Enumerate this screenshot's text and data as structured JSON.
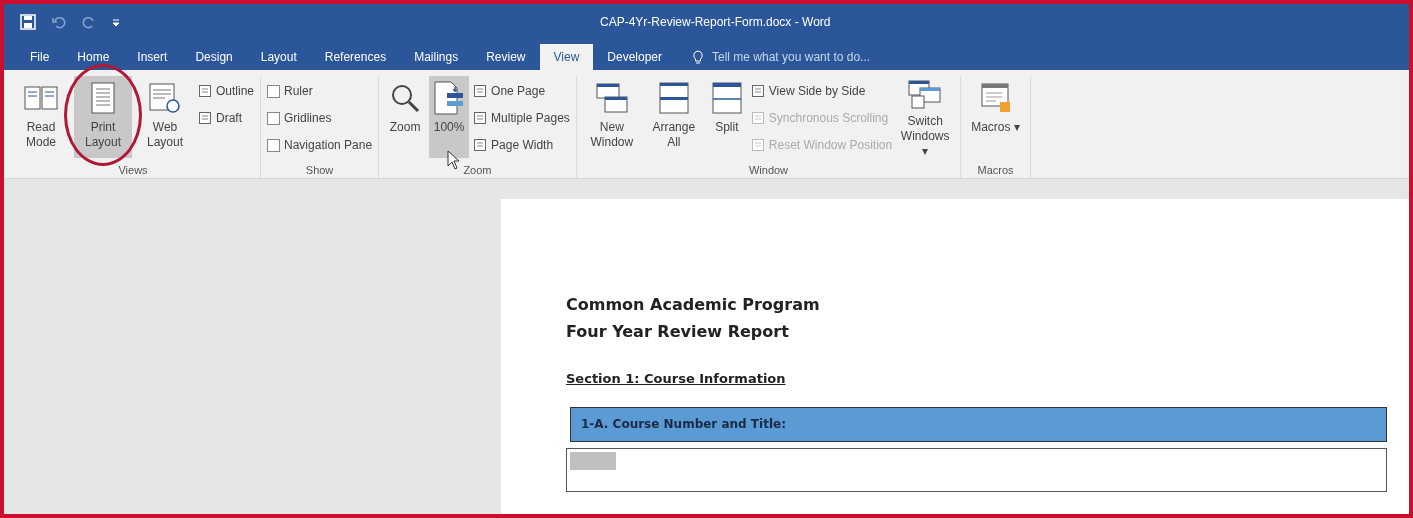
{
  "title_bar": {
    "title": "CAP-4Yr-Review-Report-Form.docx - Word"
  },
  "tabs": [
    {
      "label": "File",
      "selected": false
    },
    {
      "label": "Home",
      "selected": false
    },
    {
      "label": "Insert",
      "selected": false
    },
    {
      "label": "Design",
      "selected": false
    },
    {
      "label": "Layout",
      "selected": false
    },
    {
      "label": "References",
      "selected": false
    },
    {
      "label": "Mailings",
      "selected": false
    },
    {
      "label": "Review",
      "selected": false
    },
    {
      "label": "View",
      "selected": true
    },
    {
      "label": "Developer",
      "selected": false
    }
  ],
  "tell_me": {
    "placeholder": "Tell me what you want to do..."
  },
  "ribbon": {
    "groups": [
      {
        "label": "Views",
        "items": [
          {
            "kind": "large",
            "label": "Read Mode",
            "selected": false,
            "circled": false
          },
          {
            "kind": "large",
            "label": "Print Layout",
            "selected": true,
            "circled": true
          },
          {
            "kind": "large",
            "label": "Web Layout",
            "selected": false,
            "circled": false
          },
          {
            "kind": "column",
            "rows": [
              {
                "kind": "button",
                "label": "Outline",
                "disabled": false
              },
              {
                "kind": "button",
                "label": "Draft",
                "disabled": false
              }
            ]
          }
        ]
      },
      {
        "label": "Show",
        "items": [
          {
            "kind": "column",
            "rows": [
              {
                "kind": "checkbox",
                "label": "Ruler",
                "checked": false
              },
              {
                "kind": "checkbox",
                "label": "Gridlines",
                "checked": false
              },
              {
                "kind": "checkbox",
                "label": "Navigation Pane",
                "checked": false
              }
            ]
          }
        ]
      },
      {
        "label": "Zoom",
        "items": [
          {
            "kind": "large",
            "label": "Zoom",
            "selected": false,
            "circled": false
          },
          {
            "kind": "large",
            "label": "100%",
            "selected": true,
            "circled": false
          },
          {
            "kind": "column",
            "rows": [
              {
                "kind": "button",
                "label": "One Page",
                "disabled": false
              },
              {
                "kind": "button",
                "label": "Multiple Pages",
                "disabled": false
              },
              {
                "kind": "button",
                "label": "Page Width",
                "disabled": false
              }
            ]
          }
        ]
      },
      {
        "label": "Window",
        "items": [
          {
            "kind": "large",
            "label": "New Window",
            "selected": false,
            "circled": false
          },
          {
            "kind": "large",
            "label": "Arrange All",
            "selected": false,
            "circled": false
          },
          {
            "kind": "large",
            "label": "Split",
            "selected": false,
            "circled": false
          },
          {
            "kind": "column",
            "rows": [
              {
                "kind": "button",
                "label": "View Side by Side",
                "disabled": false
              },
              {
                "kind": "button",
                "label": "Synchronous Scrolling",
                "disabled": true
              },
              {
                "kind": "button",
                "label": "Reset Window Position",
                "disabled": true
              }
            ]
          },
          {
            "kind": "large",
            "label": "Switch Windows ▾",
            "selected": false,
            "circled": false
          }
        ]
      },
      {
        "label": "Macros",
        "items": [
          {
            "kind": "large",
            "label": "Macros ▾",
            "selected": false,
            "circled": false
          }
        ]
      }
    ]
  },
  "document": {
    "title_lines": [
      "Common Academic Program",
      "Four Year Review Report"
    ],
    "section_heading": "Section 1: Course Information",
    "table_header": "1-A. Course Number and Title:"
  }
}
